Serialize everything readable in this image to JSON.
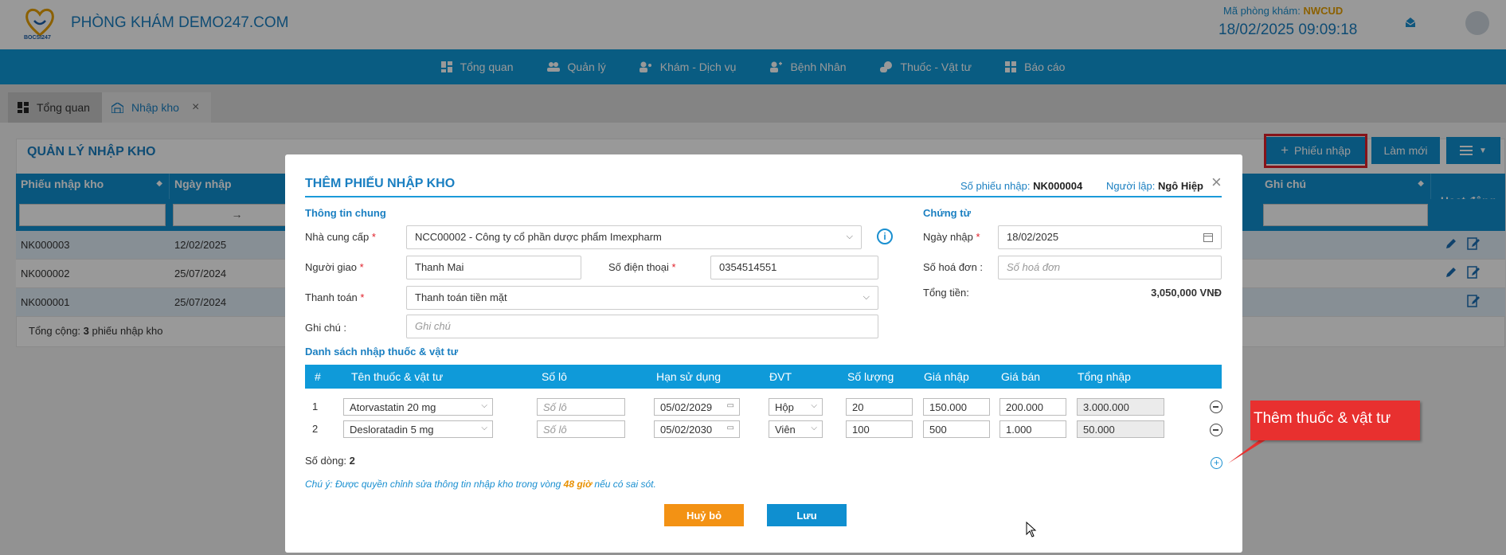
{
  "header": {
    "logo_text": "BOCSI247",
    "clinic_name": "PHÒNG KHÁM DEMO247.COM",
    "clinic_code_label": "Mã phòng khám:",
    "clinic_code": "NWCUD",
    "datetime": "18/02/2025 09:09:18"
  },
  "nav": {
    "items": [
      {
        "label": "Tổng quan",
        "icon": "dashboard-icon"
      },
      {
        "label": "Quản lý",
        "icon": "users-icon"
      },
      {
        "label": "Khám - Dịch vụ",
        "icon": "stethoscope-icon"
      },
      {
        "label": "Bệnh Nhân",
        "icon": "patient-icon"
      },
      {
        "label": "Thuốc - Vật tư",
        "icon": "pills-icon"
      },
      {
        "label": "Báo cáo",
        "icon": "report-icon"
      }
    ]
  },
  "tabs": {
    "overview": "Tổng quan",
    "import": "Nhập kho",
    "close": "×"
  },
  "page": {
    "title": "QUẢN LÝ NHẬP KHO",
    "add_button": "Phiếu nhập",
    "refresh_button": "Làm mới",
    "columns": [
      "Phiếu nhập kho",
      "Ngày nhập",
      "Ghi chú",
      "Hoạt động"
    ],
    "date_arrow": "→",
    "rows": [
      {
        "code": "NK000003",
        "date": "12/02/2025"
      },
      {
        "code": "NK000002",
        "date": "25/07/2024"
      },
      {
        "code": "NK000001",
        "date": "25/07/2024"
      }
    ],
    "footer_prefix": "Tổng cộng:",
    "footer_count": "3",
    "footer_suffix": "phiếu nhập kho"
  },
  "modal": {
    "title": "THÊM PHIẾU NHẬP KHO",
    "so_phieu_label": "Số phiếu nhập:",
    "so_phieu": "NK000004",
    "nguoi_lap_label": "Người lập:",
    "nguoi_lap": "Ngô Hiệp",
    "close": "×",
    "section_general": "Thông tin chung",
    "section_docs": "Chứng từ",
    "supplier_label": "Nhà cung cấp",
    "supplier_value": "NCC00002 - Công ty cổ phần dược phẩm Imexpharm",
    "deliverer_label": "Người giao",
    "deliverer_value": "Thanh Mai",
    "phone_label": "Số điện thoại",
    "phone_value": "0354514551",
    "payment_label": "Thanh toán",
    "payment_value": "Thanh toán tiền mặt",
    "note_label": "Ghi chú",
    "note_placeholder": "Ghi chú",
    "date_label": "Ngày nhập",
    "date_value": "18/02/2025",
    "invoice_label": "Số hoá đơn",
    "invoice_placeholder": "Số hoá đơn",
    "total_label": "Tổng tiền:",
    "total_value": "3,050,000 VNĐ",
    "section_list": "Danh sách nhập thuốc & vật tư",
    "grid_columns": [
      "#",
      "Tên thuốc & vật tư",
      "Số lô",
      "Hạn sử dụng",
      "ĐVT",
      "Số lượng",
      "Giá nhập",
      "Giá bán",
      "Tổng nhập"
    ],
    "items": [
      {
        "no": "1",
        "name": "Atorvastatin 20 mg",
        "lot_placeholder": "Số lô",
        "expiry": "05/02/2029",
        "unit": "Hộp",
        "qty": "20",
        "import_price": "150.000",
        "sale_price": "200.000",
        "total": "3.000.000"
      },
      {
        "no": "2",
        "name": "Desloratadin 5 mg",
        "lot_placeholder": "Số lô",
        "expiry": "05/02/2030",
        "unit": "Viên",
        "qty": "100",
        "import_price": "500",
        "sale_price": "1.000",
        "total": "50.000"
      }
    ],
    "rows_label": "Số dòng:",
    "rows_count": "2",
    "note_prefix": "Chú ý: Được quyền chỉnh sửa thông tin nhập kho trong vòng",
    "note_hours": "48 giờ",
    "note_suffix": "nếu có sai sót.",
    "cancel_button": "Huỷ bỏ",
    "save_button": "Lưu"
  },
  "callout": {
    "text": "Thêm thuốc & vật tư"
  },
  "colors": {
    "primary": "#0f9ad9",
    "cancel": "#f39214",
    "save": "#0f8fd0",
    "callout": "#e8302f"
  }
}
